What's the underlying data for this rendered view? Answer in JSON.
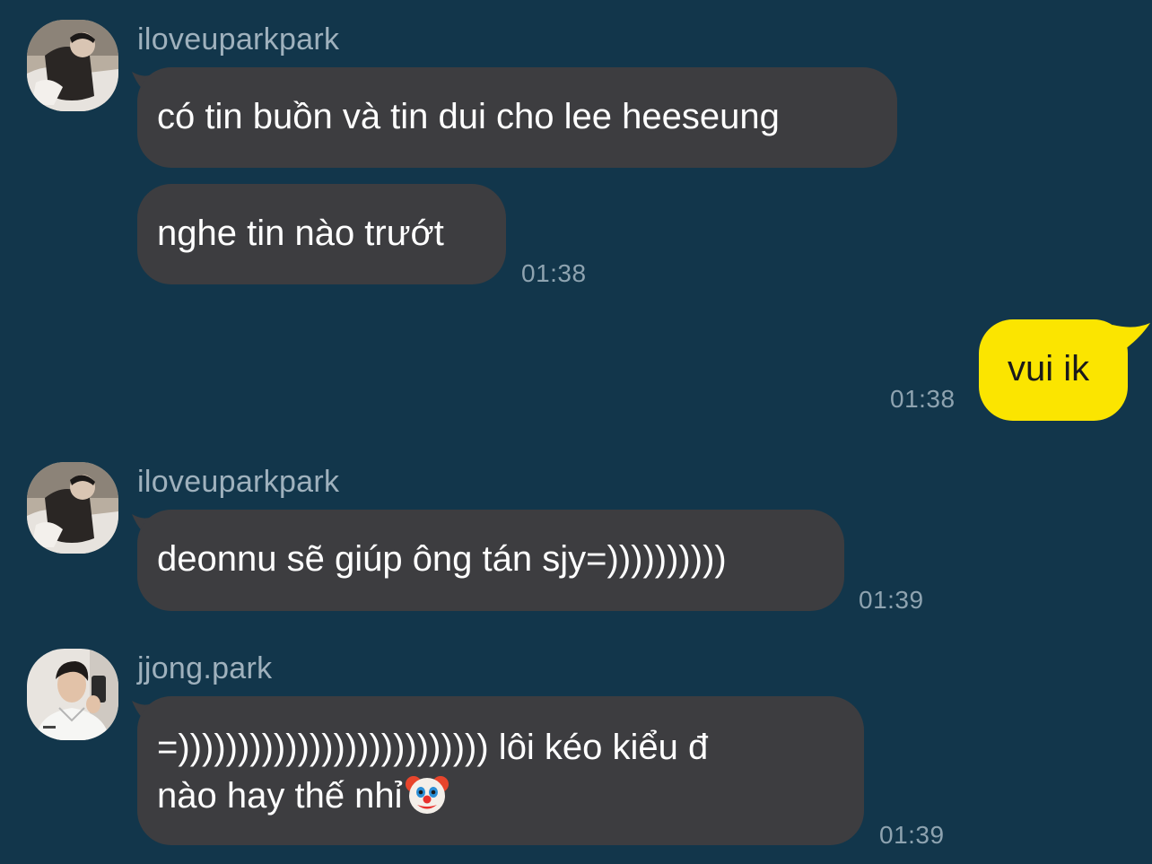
{
  "messages": [
    {
      "sender": "iloveuparkpark",
      "bubbles": [
        "có tin buồn và tin dui cho lee heeseung",
        "nghe tin nào trướt"
      ],
      "time": "01:38"
    },
    {
      "sender": "me",
      "bubbles": [
        "vui ik"
      ],
      "time": "01:38"
    },
    {
      "sender": "iloveuparkpark",
      "bubbles": [
        "deonnu sẽ giúp ông tán sjy=))))))))))"
      ],
      "time": "01:39"
    },
    {
      "sender": "jjong.park",
      "bubbles": [
        [
          "=)))))))))))))))))))))))))) lôi kéo kiểu đ",
          "nào hay thế nhỉ"
        ]
      ],
      "time": "01:39",
      "emoji": "clown-face-emoji"
    }
  ],
  "colors": {
    "background": "#12364b",
    "incoming_bubble": "#3d3d40",
    "outgoing_bubble": "#fbe500",
    "username": "#9fb1bd",
    "timestamp": "#8ea3b0"
  },
  "icons": [
    "avatar-photo-iloveuparkpark",
    "avatar-photo-jjong-park",
    "clown-face-emoji"
  ]
}
